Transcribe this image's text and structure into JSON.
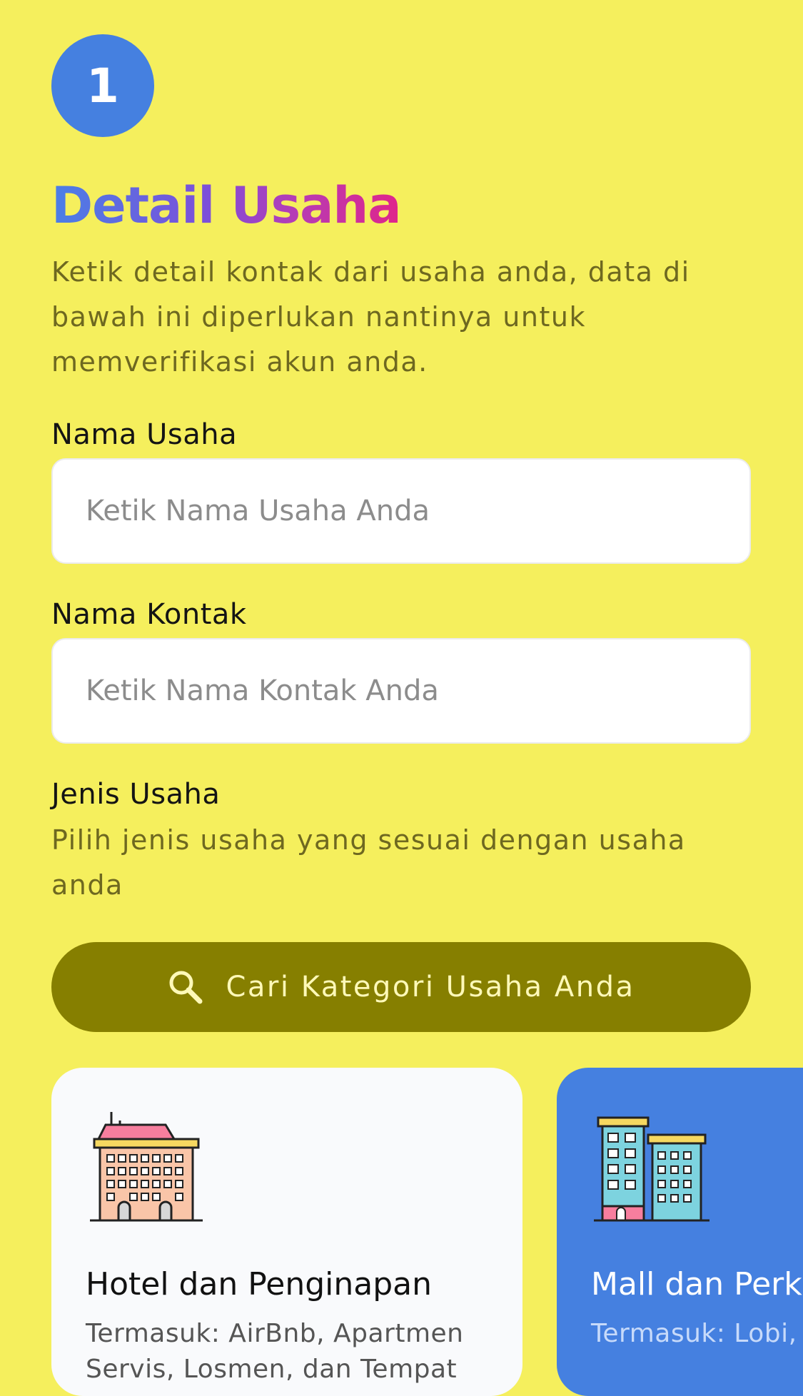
{
  "step": {
    "number": "1"
  },
  "header": {
    "title": "Detail Usaha",
    "description": "Ketik detail kontak dari usaha anda, data di bawah ini diperlukan nantinya untuk memverifikasi akun anda."
  },
  "form": {
    "nama_usaha": {
      "label": "Nama Usaha",
      "placeholder": "Ketik Nama Usaha Anda",
      "value": ""
    },
    "nama_kontak": {
      "label": "Nama Kontak",
      "placeholder": "Ketik Nama Kontak Anda",
      "value": ""
    },
    "jenis_usaha": {
      "label": "Jenis Usaha",
      "description": "Pilih jenis usaha yang sesuai dengan usaha anda",
      "search_button_label": "Cari Kategori Usaha Anda",
      "search_icon": "search-icon"
    }
  },
  "categories": [
    {
      "title": "Hotel dan Penginapan",
      "description": "Termasuk: AirBnb, Apartmen Servis, Losmen, dan Tempat",
      "icon": "hotel-building-icon",
      "selected": false
    },
    {
      "title": "Mall dan Perkantoran",
      "description": "Termasuk: Lobi, Pasar, Supermarket",
      "icon": "office-buildings-icon",
      "selected": true
    }
  ],
  "colors": {
    "background": "#F5EF5D",
    "accent": "#4580E0",
    "button": "#867F00",
    "title_gradient": [
      "#4A7FE6",
      "#7D4FD9",
      "#E0258A"
    ]
  }
}
